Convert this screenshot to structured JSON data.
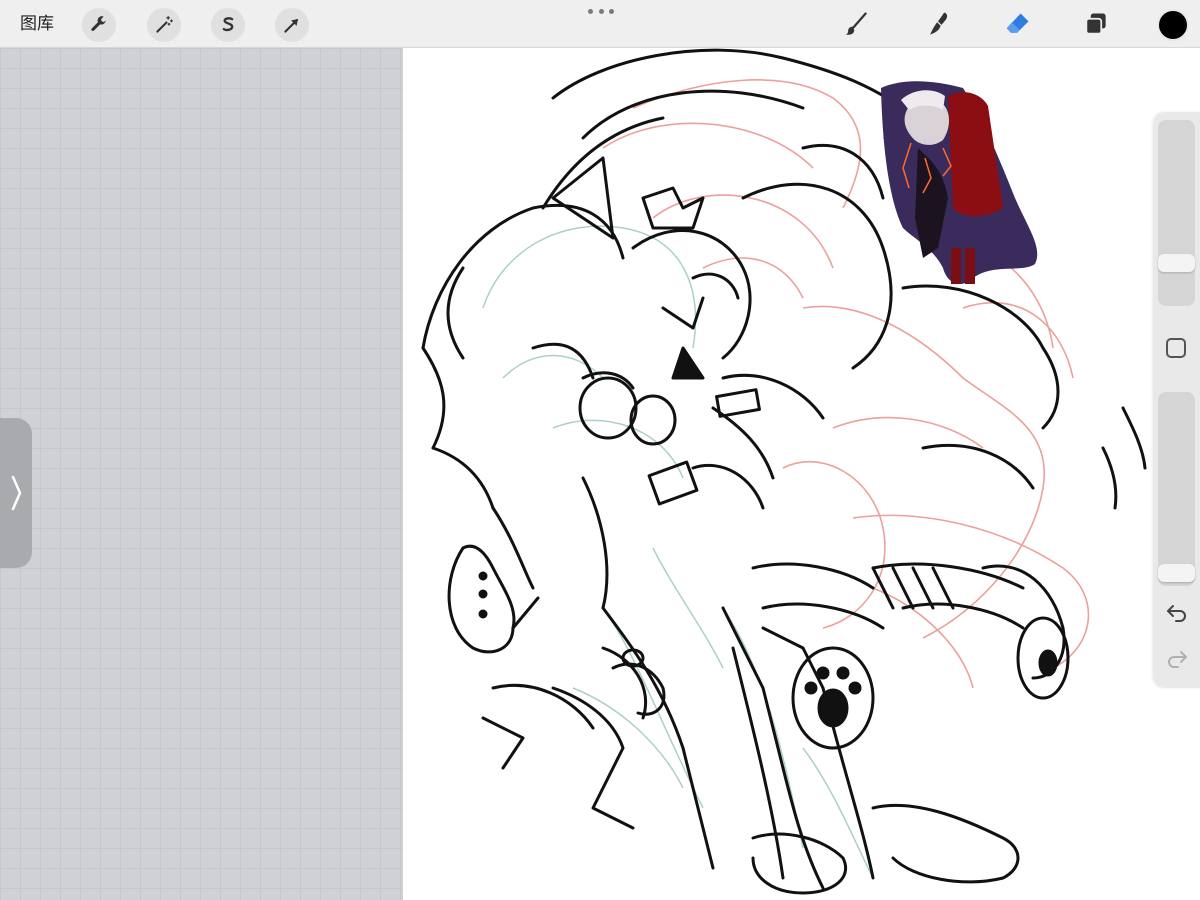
{
  "toolbar": {
    "gallery_label": "图库",
    "left_tools": [
      {
        "name": "actions",
        "icon": "wrench-icon"
      },
      {
        "name": "adjustments",
        "icon": "magic-wand-icon"
      },
      {
        "name": "selection",
        "icon": "selection-s-icon"
      },
      {
        "name": "transform",
        "icon": "arrow-cursor-icon"
      }
    ],
    "right_tools": [
      {
        "name": "brush",
        "icon": "brush-icon",
        "active": false
      },
      {
        "name": "smudge",
        "icon": "smudge-icon",
        "active": false
      },
      {
        "name": "eraser",
        "icon": "eraser-icon",
        "active": true
      },
      {
        "name": "layers",
        "icon": "layers-icon",
        "active": false
      }
    ],
    "current_color": "#000000",
    "active_tool_color": "#2f7de1"
  },
  "sidebar": {
    "brush_size_level": 0.2,
    "opacity_level": 0.02,
    "modify_icon": "square-icon",
    "undo_icon": "undo-arrow-icon",
    "redo_icon": "redo-arrow-icon"
  },
  "side_panel_toggle": {
    "icon": "chevron-right-icon"
  },
  "canvas": {
    "background": "#ffffff",
    "sketch_layers": [
      "line-art",
      "red-sketch",
      "teal-sketch",
      "reference-image"
    ]
  }
}
